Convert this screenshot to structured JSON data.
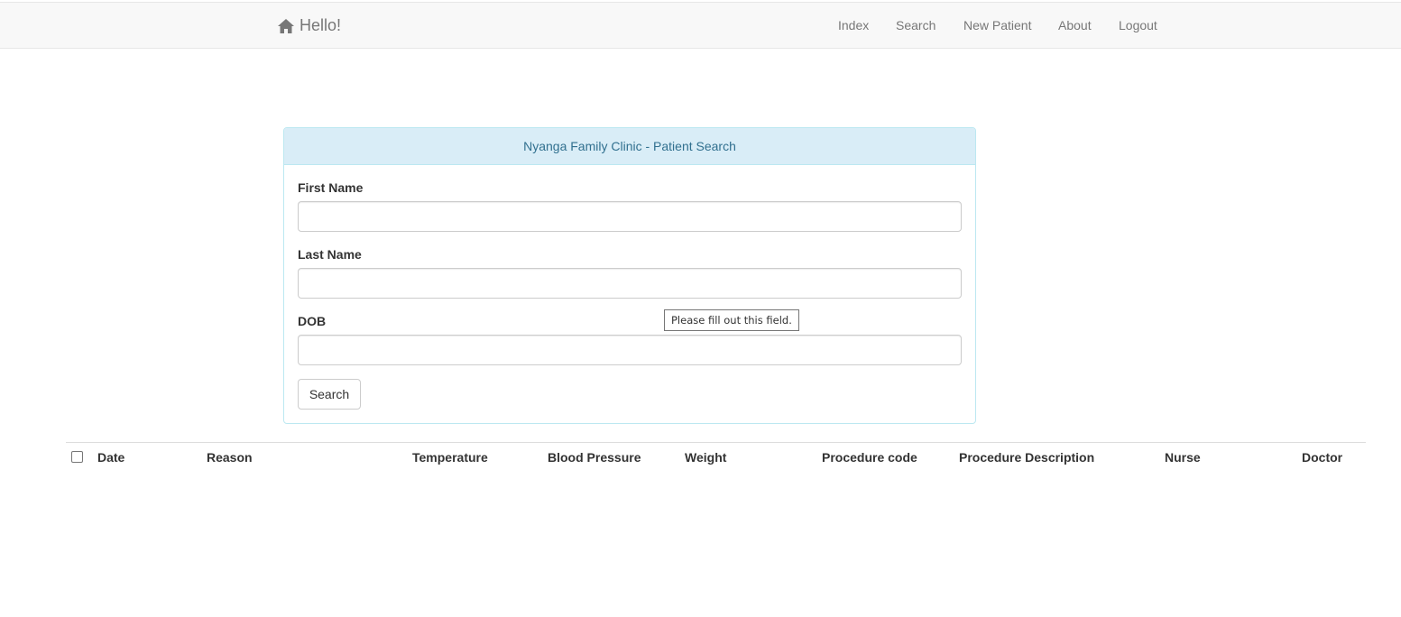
{
  "navbar": {
    "brand": "Hello!",
    "links": [
      "Index",
      "Search",
      "New Patient",
      "About",
      "Logout"
    ]
  },
  "panel": {
    "title": "Nyanga Family Clinic - Patient Search",
    "fields": {
      "first_name": {
        "label": "First Name",
        "value": ""
      },
      "last_name": {
        "label": "Last Name",
        "value": ""
      },
      "dob": {
        "label": "DOB",
        "value": ""
      }
    },
    "search_button": "Search"
  },
  "tooltip": "Please fill out this field.",
  "table": {
    "headers": [
      "Date",
      "Reason",
      "Temperature",
      "Blood Pressure",
      "Weight",
      "Procedure code",
      "Procedure Description",
      "Nurse",
      "Doctor"
    ]
  }
}
